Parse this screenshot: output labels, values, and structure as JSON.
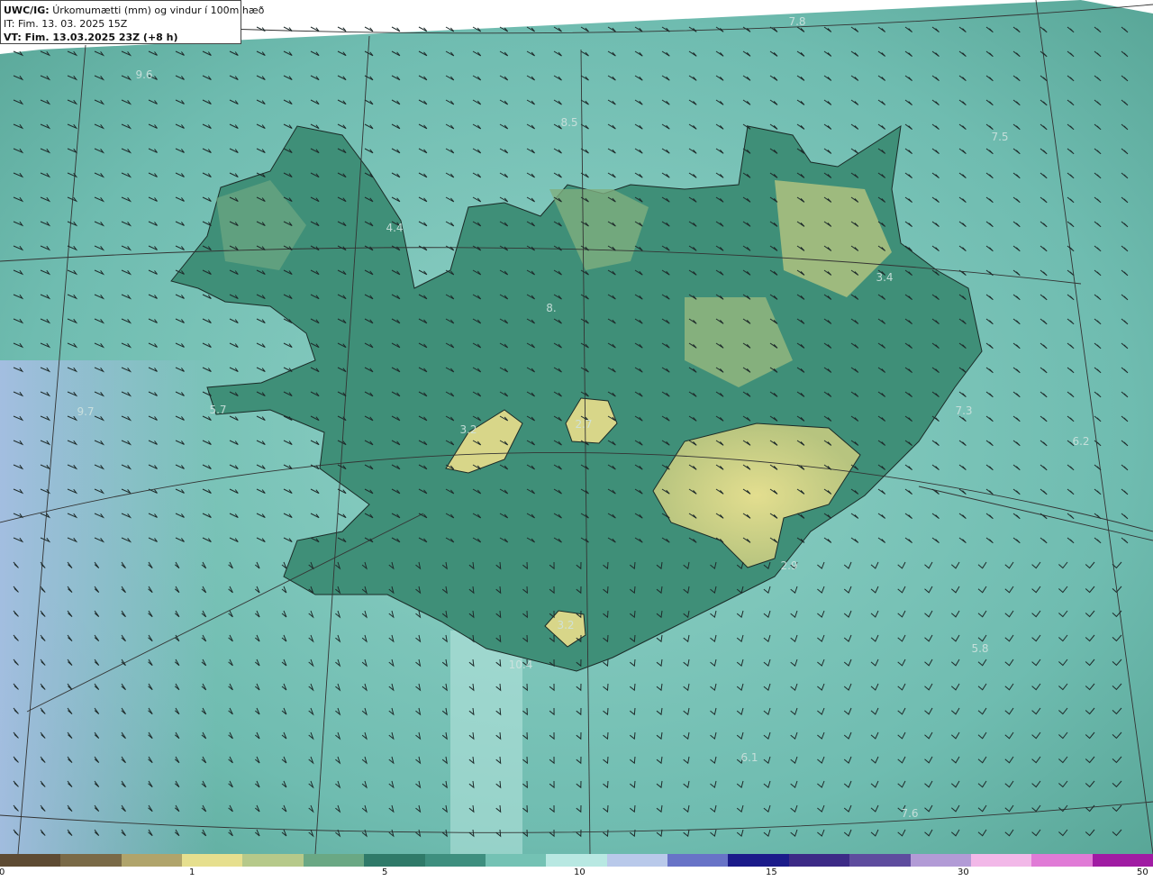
{
  "header": {
    "title_bold": "UWC/IG:",
    "title_rest": "Úrkomumætti (mm) og vindur í 100m hæð",
    "it_line": "IT: Fim. 13. 03. 2025 15Z",
    "vt_line": "VT: Fim. 13.03.2025 23Z (+8 h)"
  },
  "map_labels": [
    "7.8",
    "9.6",
    "8.5",
    "7.5",
    "4.4",
    "3.4",
    "8.",
    "9.7",
    "5.7",
    "3.2",
    "2.7",
    "7.3",
    "6.2",
    "2.9",
    "5.8",
    "10.4",
    "3.2",
    "6.1",
    "7.6"
  ],
  "colorbar": {
    "ticks": [
      "0",
      "1",
      "5",
      "10",
      "15",
      "30",
      "50"
    ],
    "colors": [
      "#5e4b33",
      "#7a6a47",
      "#b0a46b",
      "#e6df8e",
      "#b6c98a",
      "#6aa884",
      "#2f7a69",
      "#3e8f7f",
      "#74c2b4",
      "#b8e8e2",
      "#b9c9ea",
      "#6873c7",
      "#1b1b8a",
      "#3c2a86",
      "#5e4c9e",
      "#b29bd6",
      "#f2b8e8",
      "#e07bd6",
      "#a01ca3"
    ]
  },
  "colors": {
    "ocean": "#6fbcb0",
    "land_low": "#3f8f78",
    "land_high": "#d8d689",
    "grid": "#333333"
  }
}
